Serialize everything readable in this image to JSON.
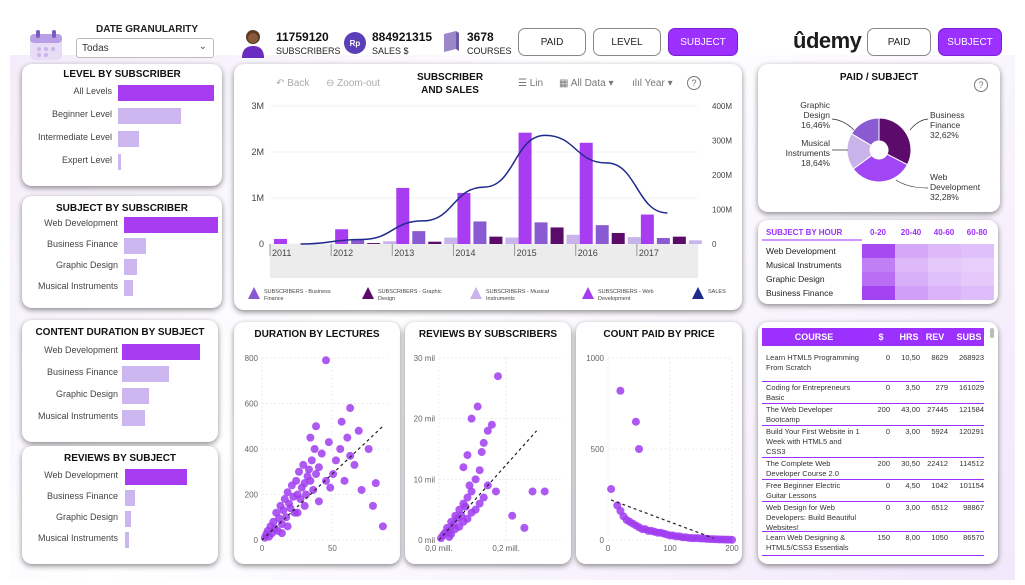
{
  "header": {
    "date_granularity_title": "DATE GRANULARITY",
    "date_granularity_value": "Todas",
    "kpis": [
      {
        "value": "11759120",
        "label": "SUBSCRIBERS"
      },
      {
        "value": "884921315",
        "label": "SALES $"
      },
      {
        "value": "3678",
        "label": "COURSES"
      }
    ],
    "currency_badge": "Rp",
    "nav_buttons": [
      "PAID",
      "LEVEL",
      "SUBJECT"
    ],
    "brand": "ûdemy",
    "right_buttons": [
      "PAID",
      "SUBJECT"
    ]
  },
  "level_by_subscriber": {
    "title": "LEVEL BY SUBSCRIBER",
    "items": [
      {
        "label": "All Levels",
        "value": 1.0
      },
      {
        "label": "Beginner Level",
        "value": 0.66
      },
      {
        "label": "Intermediate Level",
        "value": 0.22
      },
      {
        "label": "Expert Level",
        "value": 0.03
      }
    ]
  },
  "subject_by_subscriber": {
    "title": "SUBJECT BY SUBSCRIBER",
    "items": [
      {
        "label": "Web Development",
        "value": 1.0
      },
      {
        "label": "Business Finance",
        "value": 0.23
      },
      {
        "label": "Graphic Design",
        "value": 0.14
      },
      {
        "label": "Musical Instruments",
        "value": 0.1
      }
    ]
  },
  "content_duration_by_subject": {
    "title": "CONTENT DURATION BY SUBJECT",
    "items": [
      {
        "label": "Web Development",
        "value": 1.0
      },
      {
        "label": "Business Finance",
        "value": 0.6
      },
      {
        "label": "Graphic Design",
        "value": 0.34
      },
      {
        "label": "Musical Instruments",
        "value": 0.3
      }
    ]
  },
  "reviews_by_subject": {
    "title": "REVIEWS BY SUBJECT",
    "items": [
      {
        "label": "Web Development",
        "value": 1.0
      },
      {
        "label": "Business Finance",
        "value": 0.16
      },
      {
        "label": "Graphic Design",
        "value": 0.09
      },
      {
        "label": "Musical Instruments",
        "value": 0.07
      }
    ]
  },
  "main_chart": {
    "title_line1": "SUBSCRIBER",
    "title_line2": "AND SALES",
    "toolbar": {
      "back": "Back",
      "zoom_out": "Zoom-out",
      "lin": "Lin",
      "all_data": "All Data",
      "year": "Year",
      "help": "?"
    },
    "legend": [
      {
        "label": "SUBSCRIBERS - Business Finance",
        "color": "#8a5ad2"
      },
      {
        "label": "SUBSCRIBERS - Graphic Design",
        "color": "#5c0b6b"
      },
      {
        "label": "SUBSCRIBERS - Musical Instruments",
        "color": "#c8b4ea"
      },
      {
        "label": "SUBSCRIBERS - Web Development",
        "color": "#a73cf0"
      },
      {
        "label": "SALES",
        "color": "#1f2a8c"
      }
    ]
  },
  "chart_data": [
    {
      "type": "bar",
      "title": "SUBSCRIBER AND SALES",
      "xlabel": "",
      "ylabel": "",
      "x_ticks": [
        "2011",
        "2012",
        "2013",
        "2014",
        "2015",
        "2016",
        "2017"
      ],
      "y_ticks_left": [
        "0",
        "1M",
        "2M",
        "3M"
      ],
      "y_ticks_right": [
        "0",
        "100M",
        "200M",
        "300M",
        "400M"
      ],
      "ylim": [
        0,
        3000000
      ],
      "ylim_right": [
        0,
        400000000
      ],
      "categories": [
        "2011",
        "2012",
        "2013",
        "2014",
        "2015",
        "2016",
        "2017"
      ],
      "series": [
        {
          "name": "SUBSCRIBERS - Business Finance",
          "color": "#8a5ad2",
          "values": [
            0,
            90000,
            280000,
            490000,
            470000,
            410000,
            130000
          ]
        },
        {
          "name": "SUBSCRIBERS - Graphic Design",
          "color": "#5c0b6b",
          "values": [
            0,
            20000,
            50000,
            160000,
            360000,
            240000,
            160000
          ]
        },
        {
          "name": "SUBSCRIBERS - Musical Instruments",
          "color": "#c8b4ea",
          "values": [
            0,
            60000,
            140000,
            140000,
            200000,
            150000,
            80000
          ]
        },
        {
          "name": "SUBSCRIBERS - Web Development",
          "color": "#a73cf0",
          "values": [
            110000,
            320000,
            1220000,
            1110000,
            2420000,
            2200000,
            640000
          ]
        },
        {
          "name": "SALES",
          "color": "#1f2a8c",
          "type": "line",
          "values": [
            0,
            13000000,
            67000000,
            165000000,
            315000000,
            235000000,
            90000000
          ]
        }
      ]
    },
    {
      "type": "pie",
      "title": "PAID / SUBJECT",
      "categories": [
        "Business Finance",
        "Web Development",
        "Musical Instruments",
        "Graphic Design"
      ],
      "labels": [
        "Business Finance 32,62%",
        "Web Development 32,28%",
        "Musical Instruments 18,64%",
        "Graphic Design 16,46%"
      ],
      "values": [
        32.62,
        32.28,
        18.64,
        16.46
      ],
      "colors": [
        "#5c0b6b",
        "#a046f5",
        "#c8b4ea",
        "#8a5ad2"
      ]
    },
    {
      "type": "heatmap",
      "title": "SUBJECT BY HOUR",
      "columns": [
        "0-20",
        "20-40",
        "40-60",
        "60-80"
      ],
      "rows": [
        "Web Development",
        "Musical Instruments",
        "Graphic Design",
        "Business Finance"
      ],
      "values": [
        [
          0.9,
          0.35,
          0.25,
          0.2
        ],
        [
          0.6,
          0.25,
          0.15,
          0.12
        ],
        [
          0.7,
          0.3,
          0.2,
          0.15
        ],
        [
          0.95,
          0.4,
          0.28,
          0.22
        ]
      ]
    },
    {
      "type": "scatter",
      "title": "DURATION BY LECTURES",
      "x_ticks": [
        "0",
        "50"
      ],
      "y_ticks": [
        "0",
        "200",
        "400",
        "600",
        "800"
      ],
      "xlim": [
        0,
        90
      ],
      "ylim": [
        0,
        800
      ],
      "points": [
        [
          2,
          10
        ],
        [
          3,
          25
        ],
        [
          4,
          40
        ],
        [
          5,
          15
        ],
        [
          6,
          60
        ],
        [
          7,
          30
        ],
        [
          8,
          80
        ],
        [
          9,
          50
        ],
        [
          10,
          120
        ],
        [
          11,
          40
        ],
        [
          12,
          95
        ],
        [
          13,
          150
        ],
        [
          14,
          70
        ],
        [
          15,
          130
        ],
        [
          16,
          180
        ],
        [
          17,
          100
        ],
        [
          18,
          210
        ],
        [
          19,
          160
        ],
        [
          20,
          140
        ],
        [
          21,
          240
        ],
        [
          22,
          190
        ],
        [
          23,
          120
        ],
        [
          24,
          260
        ],
        [
          25,
          200
        ],
        [
          26,
          300
        ],
        [
          27,
          180
        ],
        [
          28,
          230
        ],
        [
          29,
          330
        ],
        [
          30,
          250
        ],
        [
          31,
          200
        ],
        [
          32,
          280
        ],
        [
          33,
          310
        ],
        [
          34,
          260
        ],
        [
          35,
          350
        ],
        [
          36,
          220
        ],
        [
          37,
          400
        ],
        [
          38,
          290
        ],
        [
          40,
          320
        ],
        [
          42,
          380
        ],
        [
          45,
          260
        ],
        [
          47,
          430
        ],
        [
          50,
          290
        ],
        [
          52,
          350
        ],
        [
          55,
          400
        ],
        [
          58,
          260
        ],
        [
          60,
          450
        ],
        [
          62,
          370
        ],
        [
          65,
          330
        ],
        [
          68,
          480
        ],
        [
          70,
          220
        ],
        [
          75,
          400
        ],
        [
          78,
          150
        ],
        [
          80,
          250
        ],
        [
          85,
          60
        ],
        [
          45,
          790
        ],
        [
          34,
          450
        ],
        [
          38,
          500
        ],
        [
          56,
          520
        ],
        [
          62,
          580
        ],
        [
          25,
          120
        ],
        [
          18,
          60
        ],
        [
          14,
          30
        ],
        [
          30,
          150
        ],
        [
          40,
          170
        ],
        [
          48,
          230
        ]
      ]
    },
    {
      "type": "scatter",
      "title": "REVIEWS BY SUBSCRIBERS",
      "x_ticks": [
        "0,0 mill.",
        "0,2 mill."
      ],
      "y_ticks": [
        "0 mil",
        "10 mil",
        "20 mil",
        "30 mil"
      ],
      "xlim": [
        0,
        0.3
      ],
      "ylim": [
        0,
        30
      ],
      "points": [
        [
          0.005,
          0.3
        ],
        [
          0.01,
          0.8
        ],
        [
          0.015,
          1.2
        ],
        [
          0.02,
          2
        ],
        [
          0.025,
          1.5
        ],
        [
          0.03,
          3
        ],
        [
          0.035,
          2.5
        ],
        [
          0.04,
          4
        ],
        [
          0.045,
          3.5
        ],
        [
          0.05,
          5
        ],
        [
          0.055,
          4
        ],
        [
          0.06,
          6
        ],
        [
          0.065,
          5.5
        ],
        [
          0.07,
          7
        ],
        [
          0.075,
          9
        ],
        [
          0.08,
          8
        ],
        [
          0.09,
          10
        ],
        [
          0.1,
          11.5
        ],
        [
          0.105,
          14.5
        ],
        [
          0.11,
          16
        ],
        [
          0.12,
          18
        ],
        [
          0.13,
          19
        ],
        [
          0.14,
          8
        ],
        [
          0.145,
          27
        ],
        [
          0.18,
          4
        ],
        [
          0.21,
          2
        ],
        [
          0.23,
          8
        ],
        [
          0.26,
          8
        ],
        [
          0.025,
          0.5
        ],
        [
          0.03,
          1
        ],
        [
          0.04,
          1.8
        ],
        [
          0.05,
          2.2
        ],
        [
          0.06,
          3
        ],
        [
          0.07,
          3.5
        ],
        [
          0.08,
          4.5
        ],
        [
          0.09,
          5
        ],
        [
          0.1,
          6
        ],
        [
          0.11,
          7
        ],
        [
          0.12,
          9
        ],
        [
          0.06,
          12
        ],
        [
          0.07,
          14
        ],
        [
          0.08,
          20
        ],
        [
          0.095,
          22
        ]
      ]
    },
    {
      "type": "scatter",
      "title": "COUNT PAID BY PRICE",
      "x_ticks": [
        "0",
        "100",
        "200"
      ],
      "y_ticks": [
        "0",
        "500",
        "1000"
      ],
      "xlim": [
        0,
        200
      ],
      "ylim": [
        0,
        1000
      ],
      "points": [
        [
          20,
          820
        ],
        [
          45,
          650
        ],
        [
          50,
          500
        ],
        [
          5,
          280
        ],
        [
          15,
          190
        ],
        [
          20,
          160
        ],
        [
          25,
          130
        ],
        [
          30,
          110
        ],
        [
          35,
          100
        ],
        [
          40,
          90
        ],
        [
          45,
          80
        ],
        [
          50,
          70
        ],
        [
          55,
          60
        ],
        [
          60,
          60
        ],
        [
          65,
          50
        ],
        [
          70,
          50
        ],
        [
          75,
          45
        ],
        [
          80,
          40
        ],
        [
          85,
          40
        ],
        [
          90,
          35
        ],
        [
          95,
          30
        ],
        [
          100,
          25
        ],
        [
          105,
          25
        ],
        [
          110,
          20
        ],
        [
          115,
          20
        ],
        [
          120,
          15
        ],
        [
          125,
          15
        ],
        [
          130,
          12
        ],
        [
          135,
          10
        ],
        [
          140,
          10
        ],
        [
          145,
          10
        ],
        [
          150,
          8
        ],
        [
          155,
          8
        ],
        [
          160,
          6
        ],
        [
          165,
          5
        ],
        [
          170,
          5
        ],
        [
          175,
          4
        ],
        [
          180,
          3
        ],
        [
          185,
          3
        ],
        [
          190,
          2
        ],
        [
          195,
          2
        ],
        [
          200,
          1
        ]
      ]
    },
    {
      "type": "table",
      "columns": [
        "COURSE",
        "$",
        "HRS",
        "REV",
        "SUBS"
      ],
      "rows": [
        [
          "Learn HTML5 Programming From Scratch",
          "0",
          "10,50",
          "8629",
          "268923"
        ],
        [
          "Coding for Entrepreneurs Basic",
          "0",
          "3,50",
          "279",
          "161029"
        ],
        [
          "The Web Developer Bootcamp",
          "200",
          "43,00",
          "27445",
          "121584"
        ],
        [
          "Build Your First Website in 1 Week with HTML5 and CSS3",
          "0",
          "3,00",
          "5924",
          "120291"
        ],
        [
          "The Complete Web Developer Course 2.0",
          "200",
          "30,50",
          "22412",
          "114512"
        ],
        [
          "Free Beginner Electric Guitar Lessons",
          "0",
          "4,50",
          "1042",
          "101154"
        ],
        [
          "Web Design for Web Developers: Build Beautiful Websites!",
          "0",
          "3,00",
          "6512",
          "98867"
        ],
        [
          "Learn Web Designing & HTML5/CSS3 Essentials",
          "150",
          "8,00",
          "1050",
          "86570"
        ]
      ]
    }
  ],
  "small_titles": {
    "duration": "DURATION BY LECTURES",
    "reviews": "REVIEWS BY SUBSCRIBERS",
    "count_paid": "COUNT PAID BY PRICE",
    "paid_subject": "PAID / SUBJECT",
    "subject_hour": "SUBJECT BY HOUR",
    "help": "?"
  }
}
